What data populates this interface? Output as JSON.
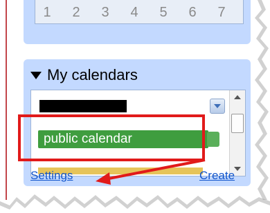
{
  "mini_calendar": {
    "dates": [
      "1",
      "2",
      "3",
      "4",
      "5",
      "6",
      "7"
    ]
  },
  "my_calendars": {
    "heading": "My calendars",
    "items": [
      {
        "label": "",
        "color": "#000000",
        "redacted": true
      },
      {
        "label": "public calendar",
        "color": "#3f9d3f"
      }
    ]
  },
  "links": {
    "settings": "Settings",
    "create": "Create"
  },
  "annotation": {
    "highlight_color": "#e11a1a",
    "arrow_color": "#e11a1a"
  }
}
